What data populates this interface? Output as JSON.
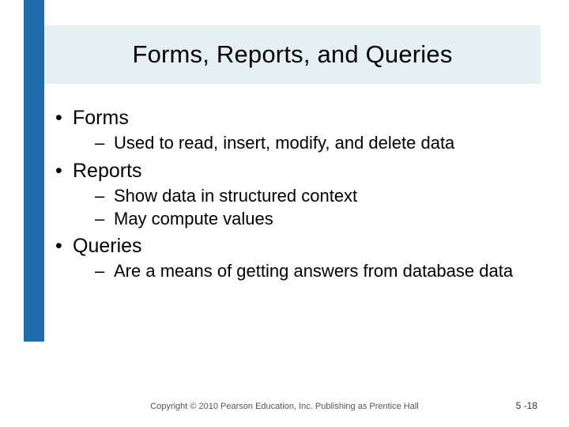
{
  "slide": {
    "title": "Forms, Reports, and Queries",
    "bullets": [
      {
        "label": "Forms",
        "subs": [
          "Used to read, insert, modify, and delete data"
        ]
      },
      {
        "label": "Reports",
        "subs": [
          "Show data in structured context",
          "May compute values"
        ]
      },
      {
        "label": "Queries",
        "subs": [
          "Are a means of getting answers from database data"
        ]
      }
    ],
    "footer": "Copyright © 2010 Pearson Education, Inc. Publishing as Prentice Hall",
    "page": "5 -18"
  }
}
